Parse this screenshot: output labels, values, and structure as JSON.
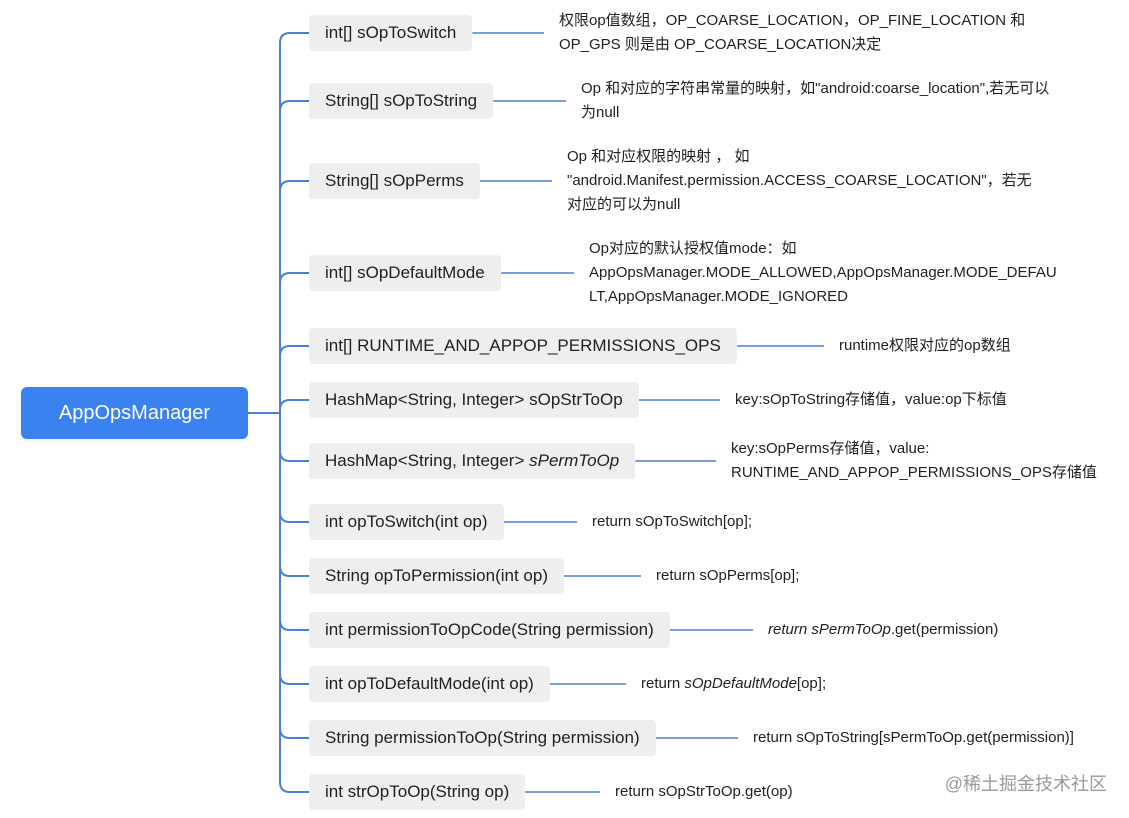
{
  "root": {
    "label": "AppOpsManager"
  },
  "nodes": [
    {
      "id": "s-op-to-switch",
      "label": "int[] sOpToSwitch",
      "note": "权限op值数组，OP_COARSE_LOCATION，OP_FINE_LOCATION 和\nOP_GPS 则是由 OP_COARSE_LOCATION决定"
    },
    {
      "id": "s-op-to-string",
      "label": "String[] sOpToString",
      "note": "Op 和对应的字符串常量的映射，如\"android:coarse_location\",若无可以\n为null"
    },
    {
      "id": "s-op-perms",
      "label": "String[] sOpPerms",
      "note": " Op 和对应权限的映射 ， 如\n\"android.Manifest.permission.ACCESS_COARSE_LOCATION\"，若无\n对应的可以为null"
    },
    {
      "id": "s-op-default-mode",
      "label": "int[] sOpDefaultMode",
      "note": "Op对应的默认授权值mode：如\nAppOpsManager.MODE_ALLOWED,AppOpsManager.MODE_DEFAU\nLT,AppOpsManager.MODE_IGNORED"
    },
    {
      "id": "runtime-and-appop-permissions-ops",
      "label": "int[] RUNTIME_AND_APPOP_PERMISSIONS_OPS",
      "note": "runtime权限对应的op数组"
    },
    {
      "id": "s-op-str-to-op",
      "label": "HashMap<String, Integer> sOpStrToOp",
      "note": "key:sOpToString存储值，value:op下标值"
    },
    {
      "id": "s-perm-to-op",
      "label_plain": "HashMap<String, Integer> ",
      "label_italic": "sPermToOp",
      "note": "key:sOpPerms存储值，value:\nRUNTIME_AND_APPOP_PERMISSIONS_OPS存储值"
    },
    {
      "id": "op-to-switch",
      "label": "int opToSwitch(int op)",
      "note": "return sOpToSwitch[op];"
    },
    {
      "id": "op-to-permission",
      "label": "String opToPermission(int op)",
      "note": "return sOpPerms[op];"
    },
    {
      "id": "permission-to-op-code",
      "label": "int permissionToOpCode(String permission)",
      "note_italic": "return sPermToOp",
      "note_plain": ".get(permission)"
    },
    {
      "id": "op-to-default-mode",
      "label": "int opToDefaultMode(int op)",
      "note_plain": "return ",
      "note_italic": "sOpDefaultMode",
      "note_plain2": "[op];"
    },
    {
      "id": "permission-to-op",
      "label": "String permissionToOp(String permission)",
      "note": "return sOpToString[sPermToOp.get(permission)]"
    },
    {
      "id": "str-op-to-op",
      "label": "int strOpToOp(String op)",
      "note": "return sOpStrToOp.get(op)"
    }
  ],
  "watermark": "@稀土掘金技术社区",
  "colors": {
    "accent": "#3a82f0",
    "node_bg": "#eeeeee",
    "line": "#4a7fd6"
  }
}
